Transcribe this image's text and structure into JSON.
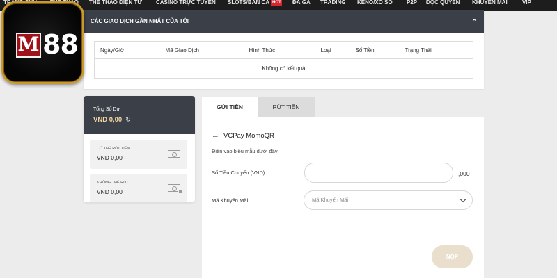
{
  "nav": {
    "items": [
      {
        "label": "TRANG CHỦ"
      },
      {
        "label": "THỂ THAO"
      },
      {
        "label": "THỂ THAO ĐIỆN TỬ"
      },
      {
        "label": "CASINO TRỰC TUYẾN"
      },
      {
        "label": "SLOTS/BẮN CÁ",
        "badge": "HOT"
      },
      {
        "label": "ĐÁ GÀ"
      },
      {
        "label": "TRADING"
      },
      {
        "label": "KENO/XỔ SỐ"
      },
      {
        "label": "P2P"
      },
      {
        "label": "ĐỘC QUYỀN"
      },
      {
        "label": "KHUYẾN MÃI"
      },
      {
        "label": "VIP"
      }
    ]
  },
  "logo": {
    "mark": "M",
    "number": "88"
  },
  "transactions": {
    "title": "CÁC GIAO DỊCH GẦN NHẤT CỦA TÔI",
    "columns": [
      "Ngày/Giờ",
      "Mã Giao Dịch",
      "Hình Thức",
      "Loại",
      "Số Tiền",
      "Trạng Thái"
    ],
    "empty_text": "Không có kết quả"
  },
  "balance": {
    "total_label": "Tổng Số Dư",
    "total_amount": "VND 0,00",
    "withdrawable_label": "CÓ THỂ RÚT TIỀN",
    "withdrawable_amount": "VND 0,00",
    "non_withdrawable_label": "KHÔNG THỂ RÚT",
    "non_withdrawable_amount": "VND 0,00"
  },
  "tabs": [
    {
      "label": "GỬI TIỀN",
      "active": true
    },
    {
      "label": "RÚT TIỀN",
      "active": false
    }
  ],
  "deposit_form": {
    "method": "VCPay MomoQR",
    "instruction": "Điền vào biểu mẫu dưới đây",
    "amount_label": "Số Tiền Chuyển (VND)",
    "amount_value": "",
    "amount_suffix": ",000",
    "promo_label": "Mã Khuyến Mãi",
    "promo_placeholder": "Mã Khuyến Mãi",
    "submit_label": "NỘP"
  },
  "colors": {
    "nav_bg": "#1d1d1d",
    "panel_header": "#3a3f48",
    "page_bg": "#ececec",
    "logo_red": "#a0121a",
    "logo_gold": "#c89a2e",
    "submit_bg": "#e9dfcc"
  },
  "icons": {
    "back": "arrow-left-icon",
    "collapse": "chevron-up-icon",
    "refresh": "refresh-icon",
    "cash": "cash-icon",
    "dropdown": "chevron-down-icon"
  }
}
